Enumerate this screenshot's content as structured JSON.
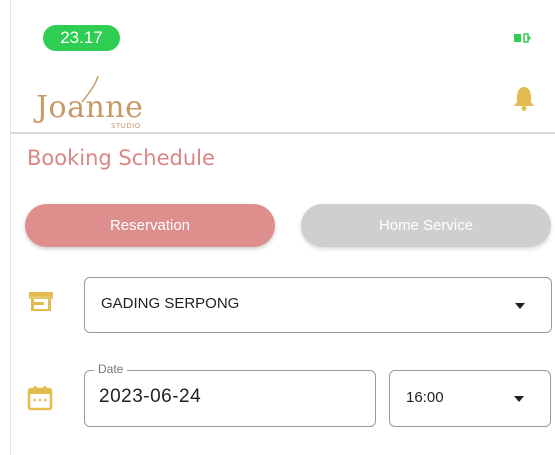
{
  "status_bar": {
    "time": "23.17"
  },
  "brand": {
    "logo_text": "Joanne",
    "logo_sub": "STUDIO",
    "color": "#c59a66"
  },
  "page": {
    "title": "Booking Schedule"
  },
  "tabs": [
    {
      "label": "Reservation",
      "active": true,
      "color": "#df8e8e"
    },
    {
      "label": "Home Service",
      "active": false,
      "color": "#cfcfcf"
    }
  ],
  "form": {
    "location": {
      "value": "GADING SERPONG",
      "icon": "store-icon"
    },
    "date": {
      "label": "Date",
      "value": "2023-06-24",
      "icon": "calendar-icon"
    },
    "time": {
      "value": "16:00"
    }
  },
  "colors": {
    "accent": "#d98686",
    "icon_gold": "#e3bb4f",
    "status_green": "#2fce52"
  }
}
